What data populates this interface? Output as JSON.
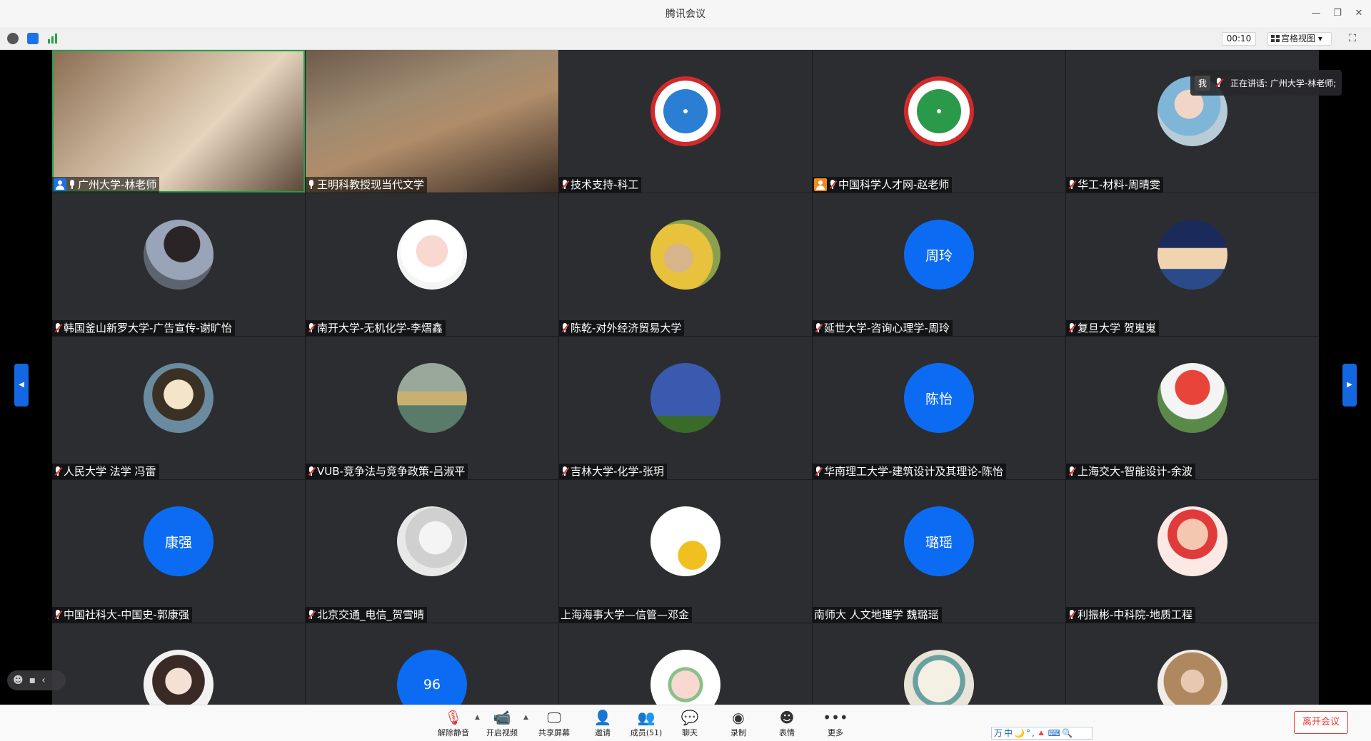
{
  "window": {
    "title": "腾讯会议"
  },
  "infobar": {
    "timer": "00:10",
    "view_label": "宫格视图"
  },
  "speaking": {
    "me_label": "我",
    "text": "正在讲话: 广州大学-林老师;"
  },
  "participants": [
    {
      "name": "广州大学-林老师",
      "type": "video",
      "badge": "host"
    },
    {
      "name": "王明科教授现当代文学",
      "type": "video"
    },
    {
      "name": "技术支持-科工",
      "type": "logo",
      "muted": true
    },
    {
      "name": "中国科学人才网-赵老师",
      "type": "logo",
      "muted": true,
      "badge": "cohost"
    },
    {
      "name": "华工-材料-周晴雯",
      "type": "photo",
      "muted": true
    },
    {
      "name": "韩国釜山新罗大学-广告宣传-谢旷怡",
      "type": "photo",
      "muted": true
    },
    {
      "name": "南开大学-无机化学-李熠鑫",
      "type": "photo",
      "muted": true
    },
    {
      "name": "陈乾-对外经济贸易大学",
      "type": "photo",
      "muted": true
    },
    {
      "name": "延世大学-咨询心理学-周玲",
      "type": "initials",
      "initials": "周玲",
      "muted": true
    },
    {
      "name": "复旦大学 贺嵬嵬",
      "type": "photo",
      "muted": true
    },
    {
      "name": "人民大学 法学 冯雷",
      "type": "photo",
      "muted": true
    },
    {
      "name": "VUB-竞争法与竞争政策-吕淑平",
      "type": "photo",
      "muted": true
    },
    {
      "name": "吉林大学-化学-张玥",
      "type": "photo",
      "muted": true
    },
    {
      "name": "华南理工大学-建筑设计及其理论-陈怡",
      "type": "initials",
      "initials": "陈怡",
      "muted": true
    },
    {
      "name": "上海交大-智能设计-余波",
      "type": "photo",
      "muted": true
    },
    {
      "name": "中国社科大-中国史-郭康强",
      "type": "initials",
      "initials": "康强",
      "muted": true
    },
    {
      "name": "北京交通_电信_贺雪晴",
      "type": "photo",
      "muted": true
    },
    {
      "name": "上海海事大学—信管—邓金",
      "type": "photo"
    },
    {
      "name": "南师大 人文地理学 魏璐瑶",
      "type": "initials",
      "initials": "璐瑶"
    },
    {
      "name": "利振彬-中科院-地质工程",
      "type": "photo",
      "muted": true
    },
    {
      "name": "",
      "type": "photo"
    },
    {
      "name": "",
      "type": "initials",
      "initials": "96"
    },
    {
      "name": "",
      "type": "photo"
    },
    {
      "name": "",
      "type": "photo"
    },
    {
      "name": "",
      "type": "photo"
    }
  ],
  "toolbar": {
    "unmute": "解除静音",
    "start_video": "开启视频",
    "share_screen": "共享屏幕",
    "invite": "邀请",
    "members": "成员(51)",
    "chat": "聊天",
    "record": "录制",
    "emoji": "表情",
    "more": "更多",
    "leave": "离开会议"
  },
  "ime": "万中🌙°,🔺⌨🔍",
  "colors": {
    "avatar_blue": "#0b6cf3",
    "leave_red": "#e53935",
    "tile_bg": "#2c2d31",
    "speaking_green": "#22a04a"
  }
}
